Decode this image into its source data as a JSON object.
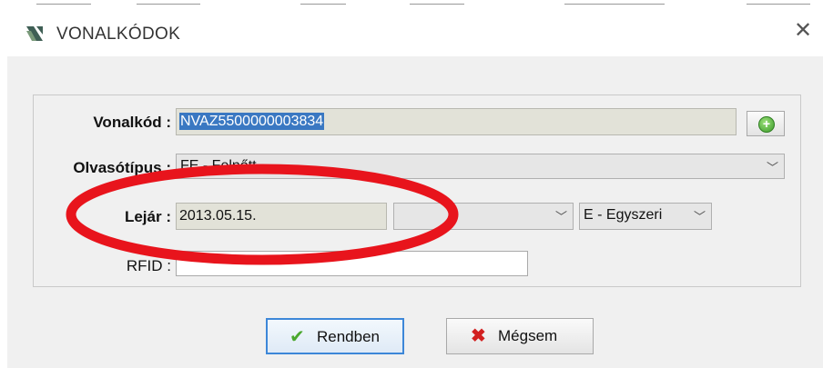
{
  "window": {
    "title": "VONALKÓDOK",
    "close_glyph": "✕",
    "icon": "app-logo-icon"
  },
  "form": {
    "barcode": {
      "label": "Vonalkód :",
      "value": "NVAZ5500000003834"
    },
    "reader_type": {
      "label": "Olvasótípus :",
      "value": "FE - Felnőtt"
    },
    "expiry": {
      "label": "Lejár :",
      "value": "2013.05.15.",
      "middle_value": "",
      "type_value": "E - Egyszeri"
    },
    "rfid": {
      "label": "RFID :",
      "value": ""
    }
  },
  "buttons": {
    "ok_label": "Rendben",
    "cancel_label": "Mégsem",
    "add_icon": "add-circle-icon"
  },
  "colors": {
    "accent": "#3a78c2",
    "annotation": "#e8141c"
  }
}
